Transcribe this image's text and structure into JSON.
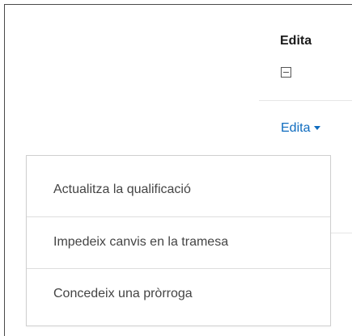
{
  "column_header": {
    "title": "Edita",
    "collapse_icon": "collapse-icon"
  },
  "edit_menu": {
    "toggle_label": "Edita",
    "caret_icon": "caret-down-icon",
    "link_color": "#0f6cbf",
    "items": [
      {
        "label": "Actualitza la qualificació"
      },
      {
        "label": "Impedeix canvis en la tramesa"
      },
      {
        "label": "Concedeix una pròrroga"
      }
    ]
  }
}
